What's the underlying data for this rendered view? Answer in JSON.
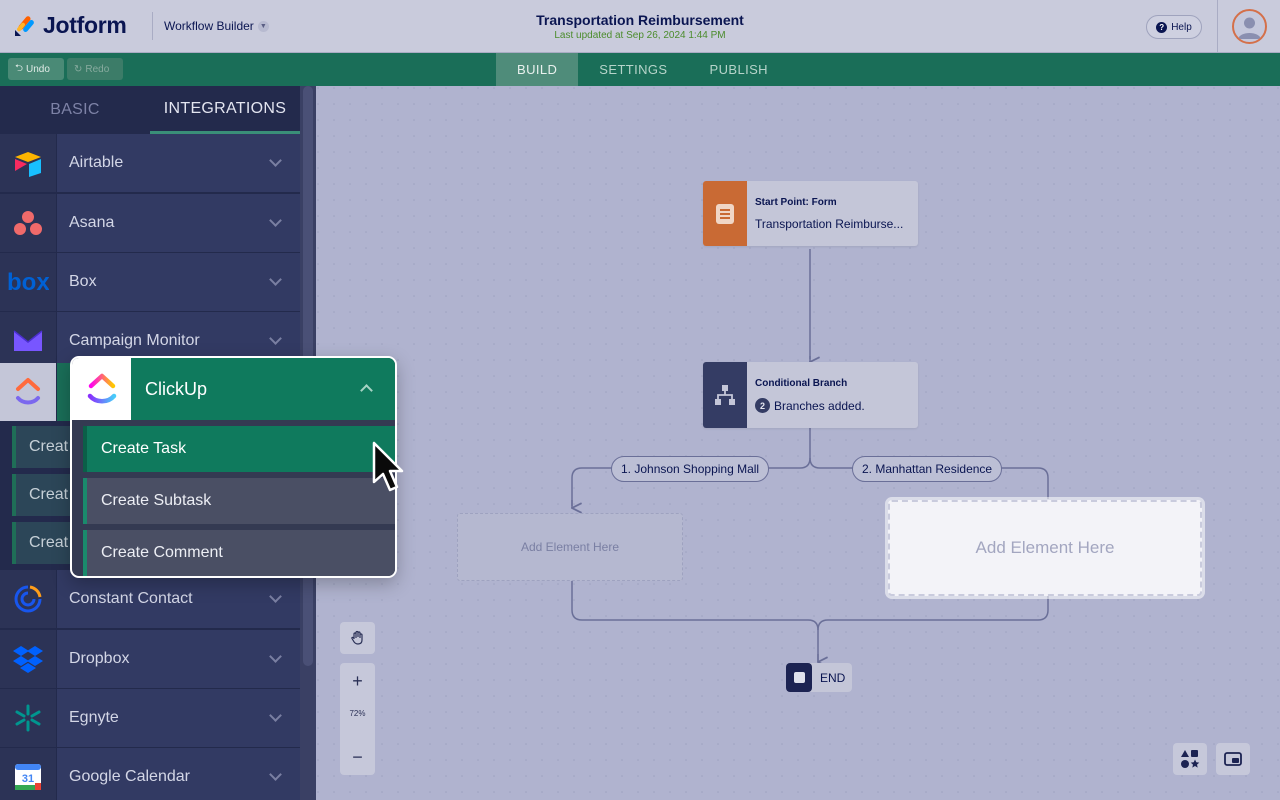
{
  "header": {
    "logo_text": "Jotform",
    "workflow_menu": "Workflow Builder",
    "form_title": "Transportation Reimbursement",
    "last_updated": "Last updated at Sep 26, 2024 1:44 PM",
    "help_label": "Help"
  },
  "toolbar": {
    "undo_label": "Undo",
    "redo_label": "Redo",
    "tabs": [
      "BUILD",
      "SETTINGS",
      "PUBLISH"
    ],
    "active_tab": "BUILD"
  },
  "left_panel": {
    "tabs": [
      "BASIC",
      "INTEGRATIONS"
    ],
    "active_tab": "INTEGRATIONS",
    "integrations": [
      {
        "label": "Airtable",
        "icon": "airtable-icon"
      },
      {
        "label": "Asana",
        "icon": "asana-icon"
      },
      {
        "label": "Box",
        "icon": "box-icon"
      },
      {
        "label": "Campaign Monitor",
        "icon": "campaign-monitor-icon"
      },
      {
        "label": "ClickUp",
        "icon": "clickup-icon"
      },
      {
        "label": "Constant Contact",
        "icon": "constant-contact-icon"
      },
      {
        "label": "Dropbox",
        "icon": "dropbox-icon"
      },
      {
        "label": "Egnyte",
        "icon": "egnyte-icon"
      },
      {
        "label": "Google Calendar",
        "icon": "google-calendar-icon"
      }
    ],
    "peek_items": [
      "Creat",
      "Creat",
      "Creat"
    ],
    "calendar_day": "31"
  },
  "clickup_popup": {
    "title": "ClickUp",
    "actions": [
      "Create Task",
      "Create Subtask",
      "Create Comment"
    ],
    "selected_action": "Create Task"
  },
  "canvas": {
    "start_node": {
      "title": "Start Point: Form",
      "subtitle": "Transportation Reimburse..."
    },
    "branch_node": {
      "title": "Conditional Branch",
      "count": "2",
      "subtitle": "Branches added."
    },
    "branches": [
      "1. Johnson Shopping Mall",
      "2. Manhattan Residence"
    ],
    "add_element_label": "Add Element Here",
    "end_label": "END",
    "zoom_level": "72%",
    "colors": {
      "start_icon_bg": "#c96a34",
      "branch_icon_bg": "#343c64",
      "accent_green": "#0f7a5d"
    }
  }
}
